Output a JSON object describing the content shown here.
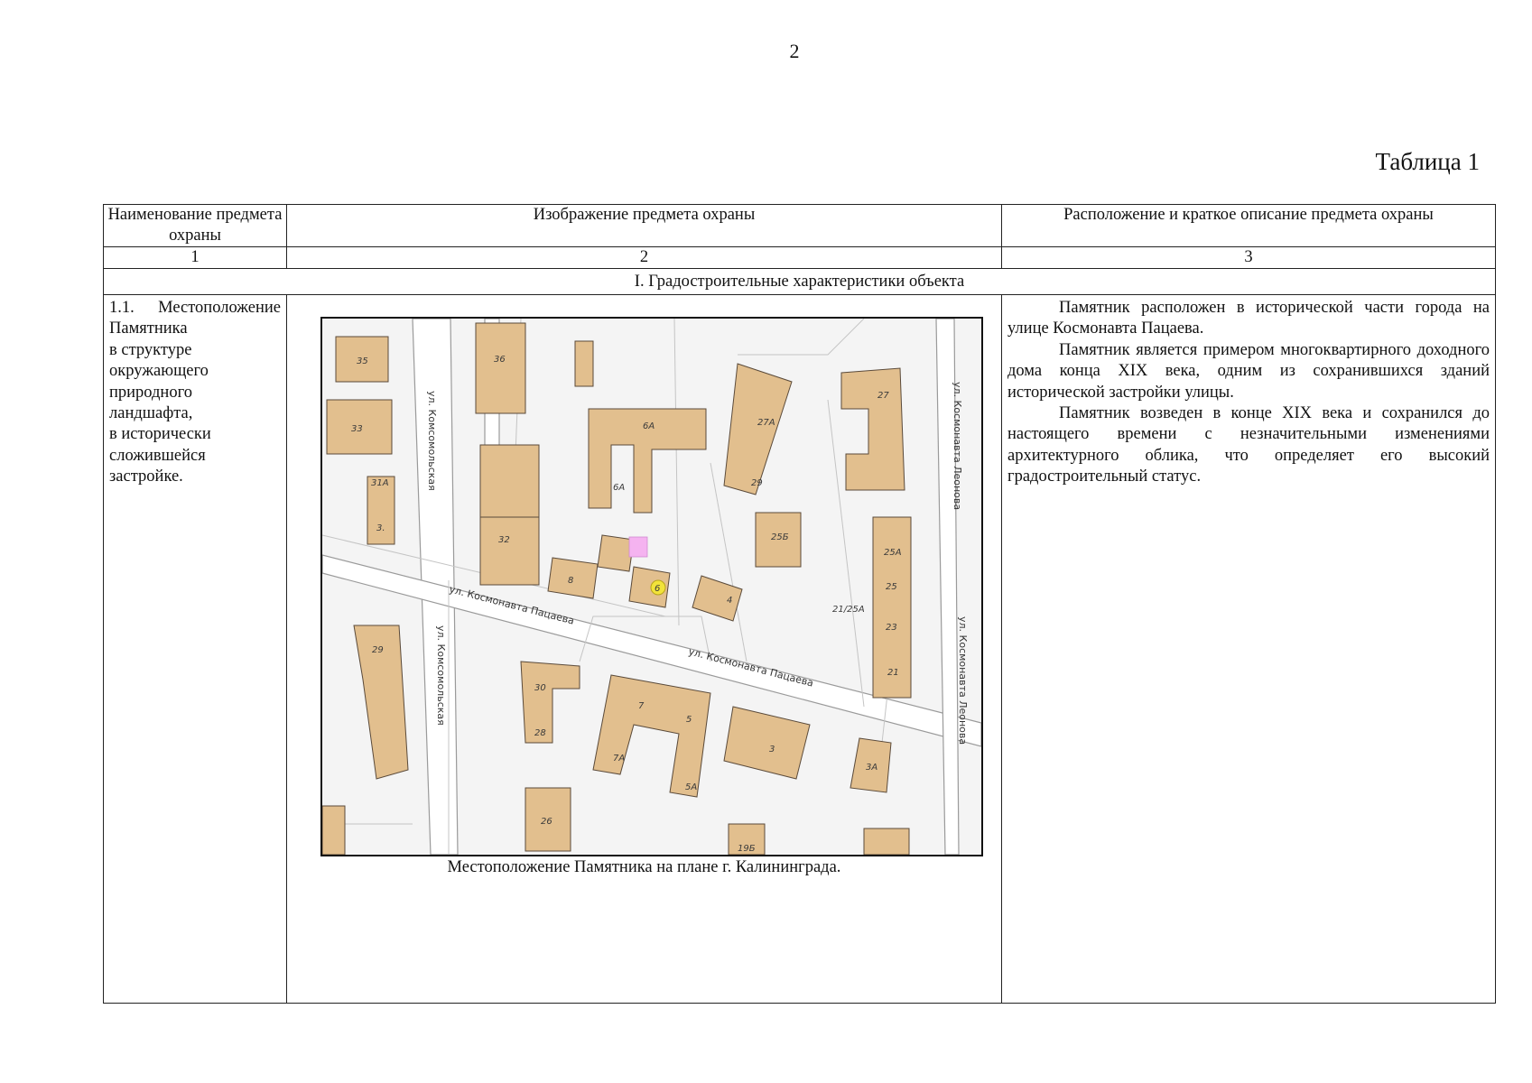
{
  "page_number": "2",
  "table_caption": "Таблица 1",
  "table": {
    "headers": [
      "Наименование предмета охраны",
      "Изображение предмета охраны",
      "Расположение и краткое описание предмета охраны"
    ],
    "column_numbers": [
      "1",
      "2",
      "3"
    ],
    "section_title": "I. Градостроительные характеристики объекта",
    "row": {
      "name_lines": [
        "1.1. Местоположение",
        "Памятника",
        "в структуре",
        "окружающего",
        "природного",
        "ландшафта,",
        "в исторически",
        "сложившейся",
        "застройке."
      ],
      "image_caption": "Местоположение Памятника на плане г. Калининграда.",
      "description": [
        "Памятник расположен в исторической части города на улице Космонавта Пацаева.",
        "Памятник является примером многоквартирного доходного дома конца XIX века, одним из сохранившихся зданий исторической застройки улицы.",
        "Памятник возведен в конце XIX века и сохранился до настоящего времени с незначительными изменениями архитектурного облика, что определяет его высокий градостроительный статус."
      ]
    }
  },
  "map": {
    "streets": {
      "komsomolskaya_north": "ул. Комсомольская",
      "komsomolskaya_south": "ул. Комсомольская",
      "patsaeva_west": "ул. Космонавта Пацаева",
      "patsaeva_east": "ул. Космонавта Пацаева",
      "leonova_north": "ул. Космонавта Леонова",
      "leonova_south": "ул. Космонавта Леонова"
    },
    "buildings": [
      "35",
      "36",
      "33",
      "31А",
      "3.",
      "6А",
      "6А",
      "27А",
      "27",
      "29",
      "32",
      "25Б",
      "25А",
      "25",
      "8",
      "6",
      "4",
      "21/25А",
      "23",
      "21",
      "29",
      "30",
      "28",
      "7",
      "5",
      "7А",
      "5А",
      "3",
      "3А",
      "26",
      "19Б"
    ],
    "colors": {
      "building": "#e2bf8e",
      "building_shadow": "#4a3f35",
      "highlight": "#f5b3f0",
      "marker": "#f2e33a",
      "road_line": "#9a9a9a",
      "ground": "#f4f4f4"
    }
  }
}
